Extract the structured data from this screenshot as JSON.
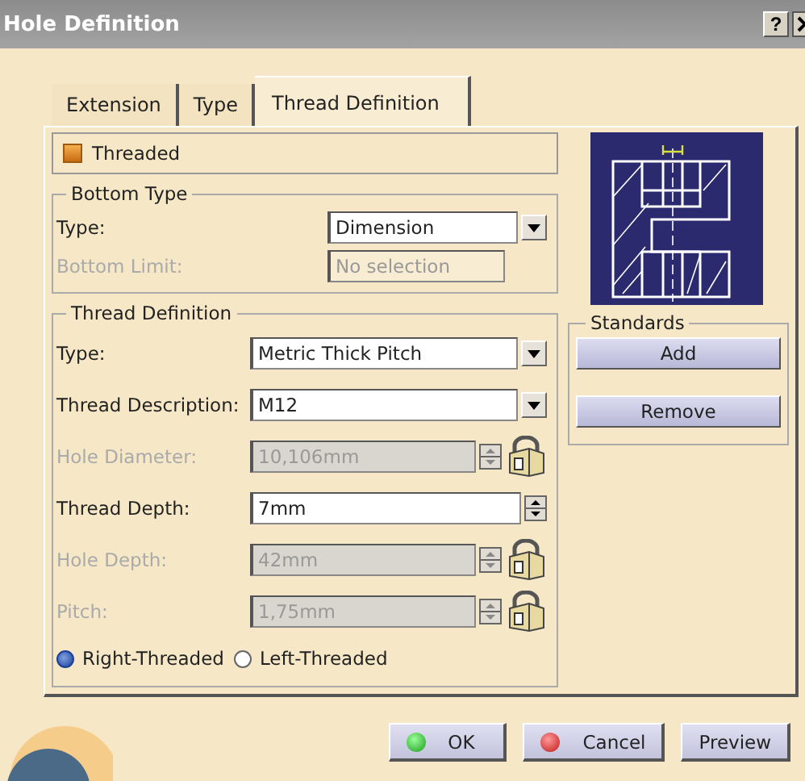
{
  "window": {
    "title": "Hole Definition",
    "help": "?"
  },
  "tabs": [
    {
      "label": "Extension",
      "selected": false
    },
    {
      "label": "Type",
      "selected": false
    },
    {
      "label": "Thread Definition",
      "selected": true
    }
  ],
  "threaded": {
    "label": "Threaded",
    "checked": true
  },
  "bottom_type": {
    "title": "Bottom Type",
    "fields": [
      {
        "kind": "combo",
        "label": "Type:",
        "value": "Dimension",
        "disabled": false
      },
      {
        "kind": "text",
        "label": "Bottom Limit:",
        "value": "No selection",
        "disabled": true
      }
    ]
  },
  "thread_definition": {
    "title": "Thread Definition",
    "fields": [
      {
        "kind": "combo",
        "label": "Type:",
        "value": "Metric Thick Pitch",
        "disabled": false
      },
      {
        "kind": "combo",
        "label": "Thread Description:",
        "value": "M12",
        "disabled": false
      },
      {
        "kind": "spin",
        "label": "Hole Diameter:",
        "value": "10,106mm",
        "disabled": true
      },
      {
        "kind": "spin",
        "label": "Thread Depth:",
        "value": "7mm",
        "disabled": false
      },
      {
        "kind": "spin",
        "label": "Hole Depth:",
        "value": "42mm",
        "disabled": true
      },
      {
        "kind": "spin",
        "label": "Pitch:",
        "value": "1,75mm",
        "disabled": true
      }
    ],
    "radios": [
      {
        "label": "Right-Threaded",
        "selected": true
      },
      {
        "label": "Left-Threaded",
        "selected": false
      }
    ]
  },
  "standards": {
    "title": "Standards",
    "buttons": [
      "Add",
      "Remove"
    ]
  },
  "buttons": [
    {
      "label": "OK",
      "kind": "ok"
    },
    {
      "label": "Cancel",
      "kind": "cancel"
    },
    {
      "label": "Preview",
      "kind": "plain"
    }
  ]
}
